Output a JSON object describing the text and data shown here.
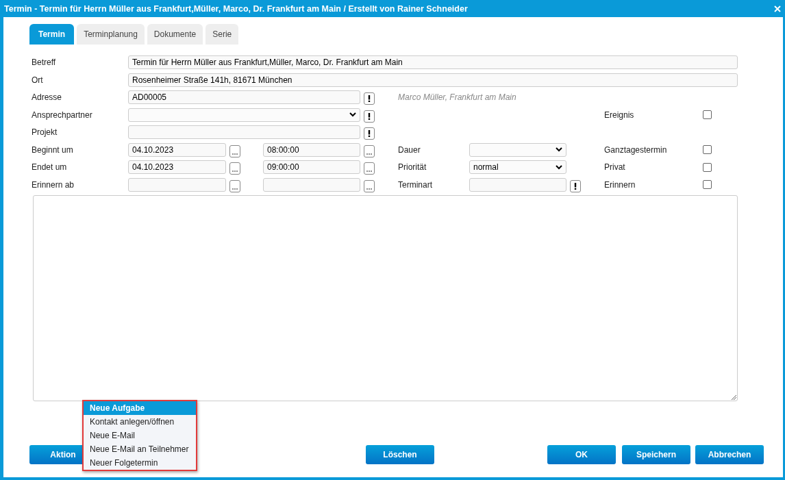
{
  "window": {
    "title": "Termin - Termin für Herrn Müller aus Frankfurt,Müller, Marco, Dr. Frankfurt am Main / Erstellt von Rainer Schneider"
  },
  "tabs": [
    {
      "label": "Termin",
      "selected": true
    },
    {
      "label": "Terminplanung",
      "selected": false
    },
    {
      "label": "Dokumente",
      "selected": false
    },
    {
      "label": "Serie",
      "selected": false
    }
  ],
  "form": {
    "betreff": {
      "label": "Betreff",
      "value": "Termin für Herrn Müller aus Frankfurt,Müller, Marco, Dr. Frankfurt am Main"
    },
    "ort": {
      "label": "Ort",
      "value": "Rosenheimer Straße 141h, 81671 München"
    },
    "adresse": {
      "label": "Adresse",
      "value": "AD00005",
      "info": "Marco Müller, Frankfurt am Main"
    },
    "ansprechpartner": {
      "label": "Ansprechpartner"
    },
    "projekt": {
      "label": "Projekt"
    },
    "beginnt": {
      "label": "Beginnt um",
      "date": "04.10.2023",
      "time": "08:00:00"
    },
    "endet": {
      "label": "Endet um",
      "date": "04.10.2023",
      "time": "09:00:00"
    },
    "erinnern_ab": {
      "label": "Erinnern ab"
    },
    "dauer": {
      "label": "Dauer"
    },
    "prioritaet": {
      "label": "Priorität",
      "value": "normal"
    },
    "terminart": {
      "label": "Terminart"
    },
    "checkboxes": [
      {
        "label": "Ereignis",
        "checked": false
      },
      {
        "label": "Ganztagestermin",
        "checked": false
      },
      {
        "label": "Privat",
        "checked": false
      },
      {
        "label": "Erinnern",
        "checked": false
      }
    ]
  },
  "action_menu": [
    {
      "label": "Neue Aufgabe",
      "selected": true
    },
    {
      "label": "Kontakt anlegen/öffnen",
      "selected": false
    },
    {
      "label": "Neue E-Mail",
      "selected": false
    },
    {
      "label": "Neue E-Mail an Teilnehmer",
      "selected": false
    },
    {
      "label": "Neuer Folgetermin",
      "selected": false
    }
  ],
  "buttons": {
    "action": "Aktion",
    "delete": "Löschen",
    "ok": "OK",
    "save": "Speichern",
    "cancel": "Abbrechen"
  }
}
